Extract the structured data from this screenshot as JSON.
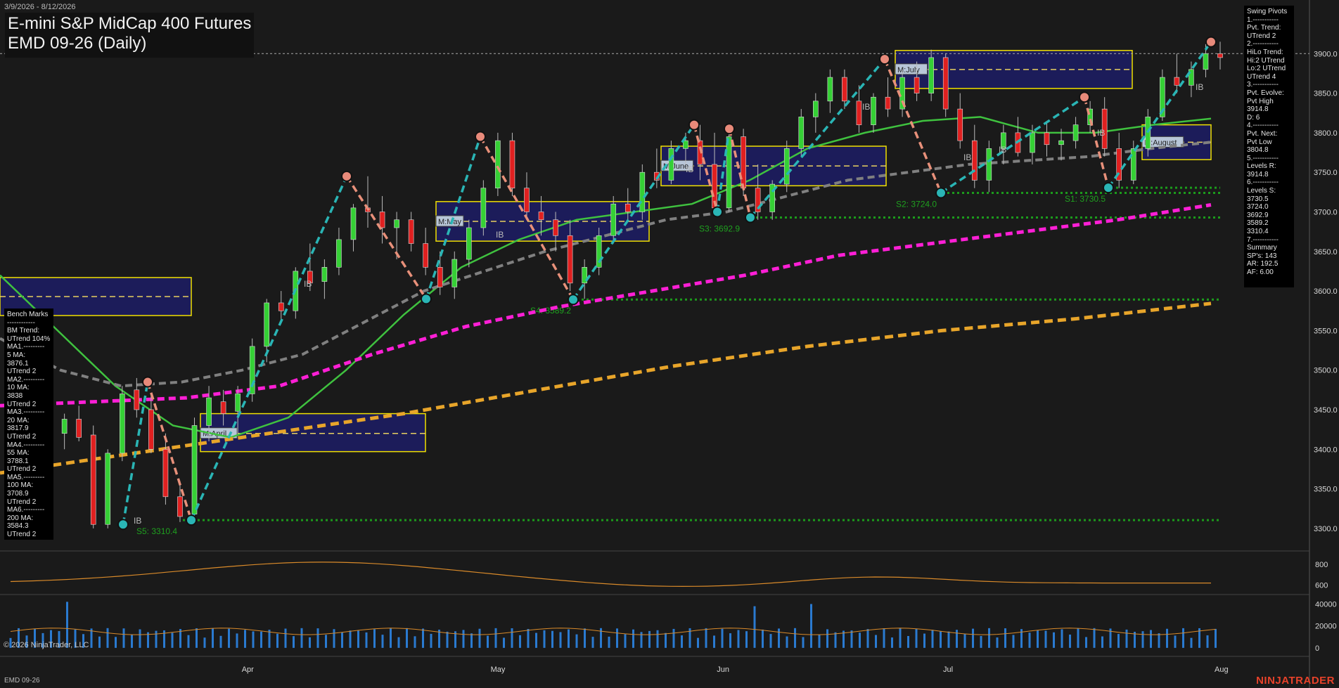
{
  "header": {
    "date_range": "3/9/2026 - 8/12/2026",
    "title": "E-mini S&P MidCap 400 Futures",
    "subtitle": "EMD 09-26 (Daily)",
    "symbol_footer": "EMD 09-26",
    "copyright": "© 2026 NinjaTrader, LLC",
    "brand": "NINJATRADER"
  },
  "colors": {
    "background": "#1a1a1a",
    "ma_green": "#3fc23f",
    "ma_gray": "#808080",
    "ma_magenta": "#ff1fd6",
    "ma_orange": "#e8a52a",
    "swing_up": "#2ab5b5",
    "swing_down": "#e8907a",
    "support_green": "#1c9a1c",
    "box_fill": "#1c1c5a",
    "box_border": "#f0e000"
  },
  "bench_marks": {
    "lines": [
      "Bench Marks",
      "------------",
      "BM Trend:",
      "UTrend 104%",
      "MA1.---------",
      "5 MA:",
      "3876.1",
      "UTrend 2",
      "MA2.---------",
      "10 MA:",
      "3838",
      "UTrend 2",
      "MA3.---------",
      "20 MA:",
      "3817.9",
      "UTrend 2",
      "MA4.---------",
      "55 MA:",
      "3788.1",
      "UTrend 2",
      "MA5.---------",
      "100 MA:",
      "3708.9",
      "UTrend 2",
      "MA6.---------",
      "200 MA:",
      "3584.3",
      "UTrend 2"
    ]
  },
  "swing_pivots": {
    "lines": [
      "Swing Pivots",
      "1.-----------",
      "Pvt. Trend:",
      "UTrend 2",
      "2.-----------",
      "HiLo Trend:",
      "Hi:2 UTrend",
      "Lo:2 UTrend",
      "UTrend 4",
      "3.-----------",
      "Pvt. Evolve:",
      "Pvt High",
      "3914.8",
      "D: 6",
      "4.-----------",
      "Pvt. Next:",
      "Pvt Low",
      "3804.8",
      "5.-----------",
      "Levels R:",
      "3914.8",
      "6.-----------",
      "Levels S:",
      "3730.5",
      "3724.0",
      "3692.9",
      "3589.2",
      "3310.4",
      "7.-----------",
      "Summary",
      "SP's: 143",
      "AR: 192.5",
      "AF: 6.00"
    ]
  },
  "chart_data": {
    "type": "candlestick",
    "ylim": [
      3275,
      3950
    ],
    "y_ticks": [
      "3300.0",
      "3350.0",
      "3400.0",
      "3450.0",
      "3500.0",
      "3550.0",
      "3600.0",
      "3650.0",
      "3700.0",
      "3750.0",
      "3800.0",
      "3850.0",
      "3900.0"
    ],
    "x_month_labels": [
      "Apr",
      "May",
      "Jun",
      "Jul",
      "Aug"
    ],
    "price_line": 3900,
    "candles": [
      {
        "o": 3390,
        "h": 3425,
        "l": 3375,
        "c": 3400
      },
      {
        "o": 3410,
        "h": 3440,
        "l": 3395,
        "c": 3430
      },
      {
        "o": 3435,
        "h": 3460,
        "l": 3400,
        "c": 3405
      },
      {
        "o": 3420,
        "h": 3445,
        "l": 3400,
        "c": 3438
      },
      {
        "o": 3438,
        "h": 3455,
        "l": 3410,
        "c": 3415
      },
      {
        "o": 3418,
        "h": 3430,
        "l": 3300,
        "c": 3305
      },
      {
        "o": 3305,
        "h": 3400,
        "l": 3300,
        "c": 3395
      },
      {
        "o": 3395,
        "h": 3480,
        "l": 3385,
        "c": 3470
      },
      {
        "o": 3475,
        "h": 3490,
        "l": 3440,
        "c": 3450
      },
      {
        "o": 3450,
        "h": 3470,
        "l": 3395,
        "c": 3400
      },
      {
        "o": 3400,
        "h": 3420,
        "l": 3330,
        "c": 3340
      },
      {
        "o": 3340,
        "h": 3360,
        "l": 3308,
        "c": 3315
      },
      {
        "o": 3318,
        "h": 3440,
        "l": 3312,
        "c": 3430
      },
      {
        "o": 3430,
        "h": 3480,
        "l": 3410,
        "c": 3465
      },
      {
        "o": 3460,
        "h": 3475,
        "l": 3430,
        "c": 3445
      },
      {
        "o": 3448,
        "h": 3480,
        "l": 3420,
        "c": 3470
      },
      {
        "o": 3470,
        "h": 3540,
        "l": 3460,
        "c": 3530
      },
      {
        "o": 3530,
        "h": 3590,
        "l": 3510,
        "c": 3585
      },
      {
        "o": 3585,
        "h": 3600,
        "l": 3560,
        "c": 3575
      },
      {
        "o": 3575,
        "h": 3630,
        "l": 3565,
        "c": 3625
      },
      {
        "o": 3625,
        "h": 3660,
        "l": 3600,
        "c": 3610
      },
      {
        "o": 3612,
        "h": 3640,
        "l": 3590,
        "c": 3630
      },
      {
        "o": 3630,
        "h": 3680,
        "l": 3620,
        "c": 3665
      },
      {
        "o": 3665,
        "h": 3710,
        "l": 3650,
        "c": 3705
      },
      {
        "o": 3705,
        "h": 3745,
        "l": 3680,
        "c": 3700
      },
      {
        "o": 3700,
        "h": 3720,
        "l": 3660,
        "c": 3680
      },
      {
        "o": 3680,
        "h": 3700,
        "l": 3640,
        "c": 3690
      },
      {
        "o": 3690,
        "h": 3700,
        "l": 3650,
        "c": 3660
      },
      {
        "o": 3660,
        "h": 3680,
        "l": 3620,
        "c": 3630
      },
      {
        "o": 3630,
        "h": 3650,
        "l": 3595,
        "c": 3605
      },
      {
        "o": 3605,
        "h": 3650,
        "l": 3590,
        "c": 3640
      },
      {
        "o": 3640,
        "h": 3690,
        "l": 3630,
        "c": 3680
      },
      {
        "o": 3680,
        "h": 3740,
        "l": 3670,
        "c": 3730
      },
      {
        "o": 3730,
        "h": 3800,
        "l": 3720,
        "c": 3790
      },
      {
        "o": 3790,
        "h": 3800,
        "l": 3720,
        "c": 3730
      },
      {
        "o": 3730,
        "h": 3750,
        "l": 3690,
        "c": 3700
      },
      {
        "o": 3700,
        "h": 3720,
        "l": 3670,
        "c": 3690
      },
      {
        "o": 3690,
        "h": 3700,
        "l": 3650,
        "c": 3670
      },
      {
        "o": 3670,
        "h": 3690,
        "l": 3600,
        "c": 3610
      },
      {
        "o": 3610,
        "h": 3640,
        "l": 3590,
        "c": 3630
      },
      {
        "o": 3630,
        "h": 3680,
        "l": 3620,
        "c": 3670
      },
      {
        "o": 3670,
        "h": 3720,
        "l": 3660,
        "c": 3710
      },
      {
        "o": 3710,
        "h": 3730,
        "l": 3690,
        "c": 3700
      },
      {
        "o": 3700,
        "h": 3760,
        "l": 3690,
        "c": 3750
      },
      {
        "o": 3750,
        "h": 3780,
        "l": 3730,
        "c": 3740
      },
      {
        "o": 3740,
        "h": 3790,
        "l": 3735,
        "c": 3780
      },
      {
        "o": 3780,
        "h": 3800,
        "l": 3760,
        "c": 3790
      },
      {
        "o": 3790,
        "h": 3810,
        "l": 3740,
        "c": 3760
      },
      {
        "o": 3760,
        "h": 3800,
        "l": 3700,
        "c": 3705
      },
      {
        "o": 3705,
        "h": 3805,
        "l": 3700,
        "c": 3795
      },
      {
        "o": 3795,
        "h": 3805,
        "l": 3720,
        "c": 3730
      },
      {
        "o": 3730,
        "h": 3760,
        "l": 3690,
        "c": 3700
      },
      {
        "o": 3700,
        "h": 3740,
        "l": 3690,
        "c": 3735
      },
      {
        "o": 3735,
        "h": 3790,
        "l": 3725,
        "c": 3780
      },
      {
        "o": 3780,
        "h": 3830,
        "l": 3770,
        "c": 3820
      },
      {
        "o": 3820,
        "h": 3850,
        "l": 3800,
        "c": 3840
      },
      {
        "o": 3840,
        "h": 3880,
        "l": 3825,
        "c": 3870
      },
      {
        "o": 3870,
        "h": 3880,
        "l": 3830,
        "c": 3840
      },
      {
        "o": 3840,
        "h": 3860,
        "l": 3800,
        "c": 3810
      },
      {
        "o": 3810,
        "h": 3850,
        "l": 3800,
        "c": 3845
      },
      {
        "o": 3845,
        "h": 3870,
        "l": 3820,
        "c": 3830
      },
      {
        "o": 3830,
        "h": 3880,
        "l": 3820,
        "c": 3870
      },
      {
        "o": 3870,
        "h": 3890,
        "l": 3840,
        "c": 3850
      },
      {
        "o": 3850,
        "h": 3905,
        "l": 3840,
        "c": 3895
      },
      {
        "o": 3895,
        "h": 3900,
        "l": 3820,
        "c": 3830
      },
      {
        "o": 3830,
        "h": 3850,
        "l": 3780,
        "c": 3790
      },
      {
        "o": 3790,
        "h": 3810,
        "l": 3730,
        "c": 3740
      },
      {
        "o": 3740,
        "h": 3790,
        "l": 3725,
        "c": 3780
      },
      {
        "o": 3780,
        "h": 3810,
        "l": 3760,
        "c": 3800
      },
      {
        "o": 3800,
        "h": 3820,
        "l": 3770,
        "c": 3775
      },
      {
        "o": 3775,
        "h": 3810,
        "l": 3760,
        "c": 3800
      },
      {
        "o": 3800,
        "h": 3815,
        "l": 3770,
        "c": 3785
      },
      {
        "o": 3785,
        "h": 3805,
        "l": 3765,
        "c": 3790
      },
      {
        "o": 3790,
        "h": 3820,
        "l": 3780,
        "c": 3810
      },
      {
        "o": 3810,
        "h": 3840,
        "l": 3800,
        "c": 3830
      },
      {
        "o": 3830,
        "h": 3845,
        "l": 3770,
        "c": 3780
      },
      {
        "o": 3780,
        "h": 3800,
        "l": 3730,
        "c": 3740
      },
      {
        "o": 3740,
        "h": 3790,
        "l": 3735,
        "c": 3780
      },
      {
        "o": 3780,
        "h": 3830,
        "l": 3770,
        "c": 3820
      },
      {
        "o": 3820,
        "h": 3880,
        "l": 3815,
        "c": 3870
      },
      {
        "o": 3870,
        "h": 3900,
        "l": 3850,
        "c": 3860
      },
      {
        "o": 3860,
        "h": 3890,
        "l": 3845,
        "c": 3880
      },
      {
        "o": 3880,
        "h": 3912,
        "l": 3870,
        "c": 3900
      },
      {
        "o": 3900,
        "h": 3915,
        "l": 3880,
        "c": 3895
      }
    ],
    "moving_averages": [
      {
        "name": "MA green",
        "color": "#3fc23f",
        "values": [
          3620,
          3550,
          3480,
          3430,
          3415,
          3440,
          3500,
          3570,
          3630,
          3665,
          3690,
          3700,
          3710,
          3740,
          3780,
          3800,
          3815,
          3820,
          3800,
          3800,
          3810,
          3817.9
        ]
      },
      {
        "name": "MA gray",
        "color": "#808080",
        "values": [
          3540,
          3500,
          3480,
          3485,
          3500,
          3520,
          3560,
          3600,
          3625,
          3650,
          3670,
          3690,
          3700,
          3720,
          3740,
          3750,
          3760,
          3765,
          3770,
          3780,
          3788.1
        ]
      },
      {
        "name": "MA magenta",
        "color": "#ff1fd6",
        "values": [
          3455,
          3460,
          3465,
          3480,
          3520,
          3555,
          3580,
          3600,
          3620,
          3645,
          3660,
          3675,
          3690,
          3708.9
        ]
      },
      {
        "name": "MA orange",
        "color": "#e8a52a",
        "values": [
          3370,
          3395,
          3420,
          3445,
          3475,
          3505,
          3530,
          3550,
          3565,
          3584.3
        ]
      }
    ],
    "swing_pivots": [
      {
        "type": "low",
        "y": 3305
      },
      {
        "type": "high",
        "y": 3485
      },
      {
        "type": "low",
        "y": 3310.4
      },
      {
        "type": "high",
        "y": 3745
      },
      {
        "type": "low",
        "y": 3590
      },
      {
        "type": "high",
        "y": 3795
      },
      {
        "type": "low",
        "y": 3589.2
      },
      {
        "type": "high",
        "y": 3810
      },
      {
        "type": "low",
        "y": 3700
      },
      {
        "type": "high",
        "y": 3805
      },
      {
        "type": "low",
        "y": 3692.9
      },
      {
        "type": "high",
        "y": 3893
      },
      {
        "type": "low",
        "y": 3724.0
      },
      {
        "type": "high",
        "y": 3845
      },
      {
        "type": "low",
        "y": 3730.5
      },
      {
        "type": "high",
        "y": 3914.8
      }
    ],
    "support_levels": [
      {
        "label": "S1: 3730.5",
        "y": 3730.5
      },
      {
        "label": "S2: 3724.0",
        "y": 3724.0
      },
      {
        "label": "S3: 3692.9",
        "y": 3692.9
      },
      {
        "label": "S4: 3589.2",
        "y": 3589.2
      },
      {
        "label": "S5: 3310.4",
        "y": 3310.4
      }
    ],
    "monthly_boxes": [
      {
        "label": "M:April",
        "high": 3445,
        "low": 3397,
        "mid": 3420
      },
      {
        "label": "M:May",
        "high": 3713,
        "low": 3663,
        "mid": 3688
      },
      {
        "label": "M:June",
        "high": 3783,
        "low": 3733,
        "mid": 3758
      },
      {
        "label": "M:July",
        "high": 3904,
        "low": 3856,
        "mid": 3880
      },
      {
        "label": "M:August",
        "high": 3810,
        "low": 3766,
        "mid": 3788
      },
      {
        "label": "",
        "high": 3617,
        "low": 3569,
        "mid": 3593
      }
    ],
    "ib_label": "IB",
    "atr_panel": {
      "y_ticks": [
        "600",
        "800"
      ],
      "ylim": [
        550,
        900
      ]
    },
    "volume_panel": {
      "y_ticks": [
        "0",
        "20000",
        "40000"
      ],
      "ylim": [
        -2000,
        48000
      ]
    }
  }
}
